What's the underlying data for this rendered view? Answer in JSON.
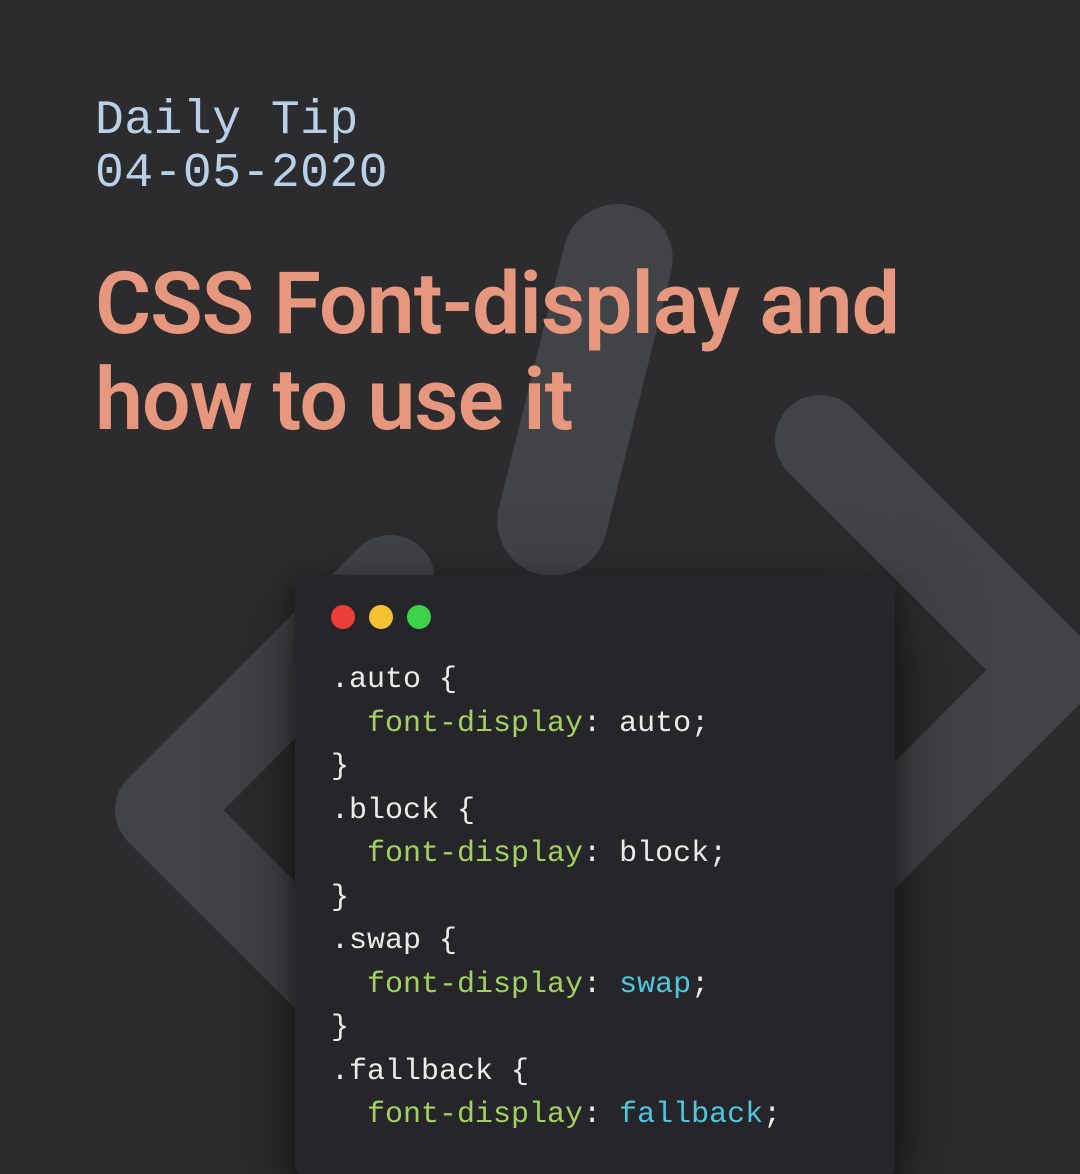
{
  "kicker": {
    "line1": "Daily Tip",
    "line2": "04-05-2020"
  },
  "title": "CSS Font-display and how to use it",
  "code": {
    "rules": [
      {
        "selector": ".auto",
        "property": "font-display",
        "value": "auto",
        "keyword": false
      },
      {
        "selector": ".block",
        "property": "font-display",
        "value": "block",
        "keyword": false
      },
      {
        "selector": ".swap",
        "property": "font-display",
        "value": "swap",
        "keyword": true
      },
      {
        "selector": ".fallback",
        "property": "font-display",
        "value": "fallback",
        "keyword": true
      }
    ]
  },
  "colors": {
    "bg": "#2c2c2e",
    "windowBg": "#26262a",
    "kicker": "#b9d1e8",
    "title": "#e7977d",
    "prop": "#a3d15f",
    "keyword": "#4fc6dd",
    "text": "#ecebe8"
  }
}
